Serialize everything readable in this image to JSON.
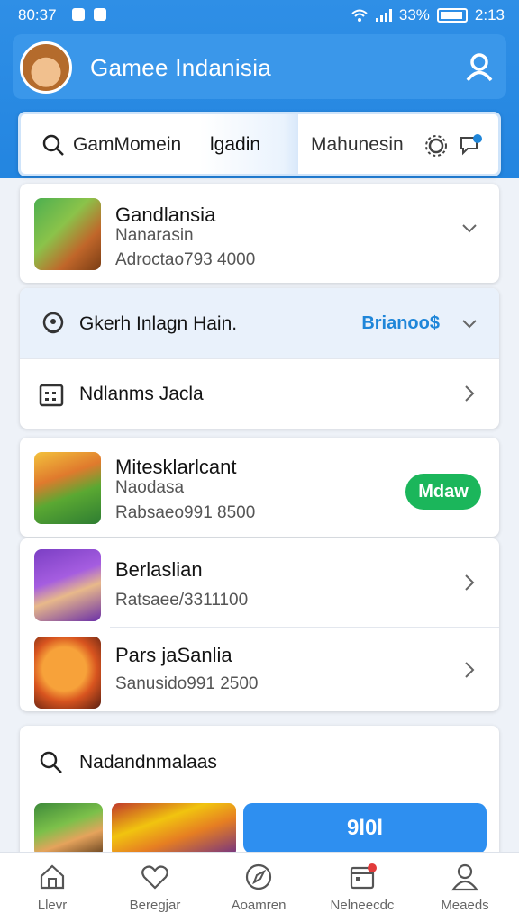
{
  "status_bar": {
    "time": "80:37",
    "battery": "33%",
    "clock": "2:13"
  },
  "header": {
    "title": "Gamee Indanisia"
  },
  "tabs": [
    {
      "label": "GamMomein"
    },
    {
      "label": "lgadin"
    },
    {
      "label": "Mahunesin"
    }
  ],
  "featured": {
    "title": "Gandlansia",
    "subtitle": "Nanarasin",
    "meta": "Adroctao793 4000"
  },
  "section_card": {
    "row1": {
      "label": "Gkerh Inlagn Hain.",
      "badge": "Brianoo$"
    },
    "row2": {
      "label": "Ndlanms Jacla"
    }
  },
  "game_list": [
    {
      "title": "Mitesklarlcant",
      "subtitle": "Naodasa",
      "meta": "Rabsaeo991 8500",
      "action": "Mdaw"
    },
    {
      "title": "Berlaslian",
      "meta": "Ratsaee/3311100"
    },
    {
      "title": "Pars jaSanlia",
      "meta": "Sanusido991 2500"
    }
  ],
  "search_section": {
    "label": "Nadandnmalaas",
    "button": "9l0l"
  },
  "bottom_nav": [
    {
      "label": "Llevr",
      "icon": "home-icon"
    },
    {
      "label": "Beregjar",
      "icon": "heart-icon"
    },
    {
      "label": "Aoamren",
      "icon": "compass-icon"
    },
    {
      "label": "Nelneecdc",
      "icon": "calendar-icon"
    },
    {
      "label": "Meaeds",
      "icon": "profile-icon"
    }
  ],
  "colors": {
    "primary": "#2385e0",
    "accent_green": "#1bb65b",
    "accent_blue_text": "#1f86d9",
    "notification": "#e23b3b"
  }
}
